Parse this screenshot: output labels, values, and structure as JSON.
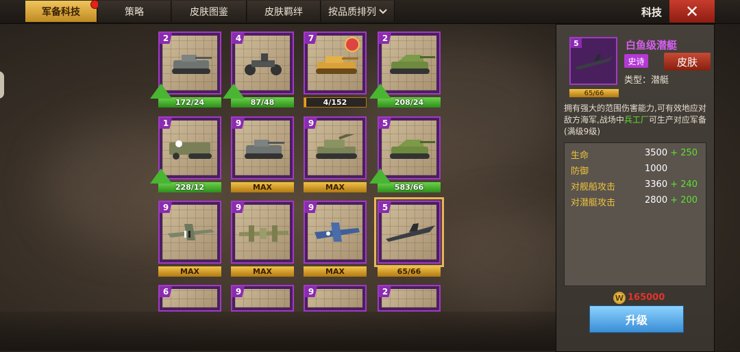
{
  "tabs": [
    {
      "label": "军备科技",
      "active": true,
      "has_dot": true
    },
    {
      "label": "策略",
      "active": false
    },
    {
      "label": "皮肤图鉴",
      "active": false
    },
    {
      "label": "皮肤羁绊",
      "active": false
    }
  ],
  "sort_label": "按品质排列",
  "header_title": "科技",
  "units": [
    {
      "level": "2",
      "kind": "tank",
      "upgradable": true,
      "bar": "green",
      "progress_text": "172/24"
    },
    {
      "level": "4",
      "kind": "motorcycle",
      "upgradable": true,
      "bar": "green",
      "progress_text": "87/48"
    },
    {
      "level": "7",
      "kind": "tank-gold",
      "upgradable": false,
      "bar": "dark",
      "progress_text": "4/152",
      "progress_fraction": 0.026,
      "medal": true
    },
    {
      "level": "2",
      "kind": "tank-destroyer",
      "upgradable": true,
      "bar": "green",
      "progress_text": "208/24"
    },
    {
      "level": "1",
      "kind": "halftrack",
      "upgradable": true,
      "bar": "green",
      "progress_text": "228/12"
    },
    {
      "level": "9",
      "kind": "tank",
      "upgradable": false,
      "bar": "gold",
      "progress_text": "MAX"
    },
    {
      "level": "9",
      "kind": "artillery",
      "upgradable": false,
      "bar": "gold",
      "progress_text": "MAX"
    },
    {
      "level": "5",
      "kind": "tank-destroyer",
      "upgradable": true,
      "bar": "green",
      "progress_text": "583/66"
    },
    {
      "level": "9",
      "kind": "fighter",
      "upgradable": false,
      "bar": "gold",
      "progress_text": "MAX"
    },
    {
      "level": "9",
      "kind": "bomber",
      "upgradable": false,
      "bar": "gold",
      "progress_text": "MAX"
    },
    {
      "level": "9",
      "kind": "fighter-blue",
      "upgradable": false,
      "bar": "gold",
      "progress_text": "MAX"
    },
    {
      "level": "5",
      "kind": "submarine",
      "upgradable": false,
      "bar": "gold",
      "progress_text": "65/66",
      "selected": true
    },
    {
      "level": "6",
      "kind": "partial"
    },
    {
      "level": "9",
      "kind": "partial"
    },
    {
      "level": "9",
      "kind": "partial"
    },
    {
      "level": "2",
      "kind": "partial"
    }
  ],
  "detail": {
    "level": "5",
    "thumb_progress": "65/66",
    "name": "白鱼级潜艇",
    "rarity": "史诗",
    "skin_button": "皮肤",
    "type_line": "类型：潜艇",
    "desc_before": "拥有强大的范围伤害能力,可有效地应对敌方海军,战场中",
    "desc_highlight": "兵工厂",
    "desc_after": "可生产对应军备(满级9级)",
    "stats": [
      {
        "label": "生命",
        "value": "3500",
        "bonus": "+ 250"
      },
      {
        "label": "防御",
        "value": "1000",
        "bonus": ""
      },
      {
        "label": "对舰船攻击",
        "value": "3360",
        "bonus": "+ 240"
      },
      {
        "label": "对潜艇攻击",
        "value": "2800",
        "bonus": "+ 200"
      }
    ],
    "coin_symbol": "W",
    "cost": "165000",
    "upgrade_label": "升级"
  },
  "colors": {
    "epic_purple": "#a33ac7",
    "gold_tab": "#f1c55c",
    "close_red": "#c83c2c",
    "upgrade_blue": "#3a8ed6",
    "plus_green": "#5fe02f"
  }
}
